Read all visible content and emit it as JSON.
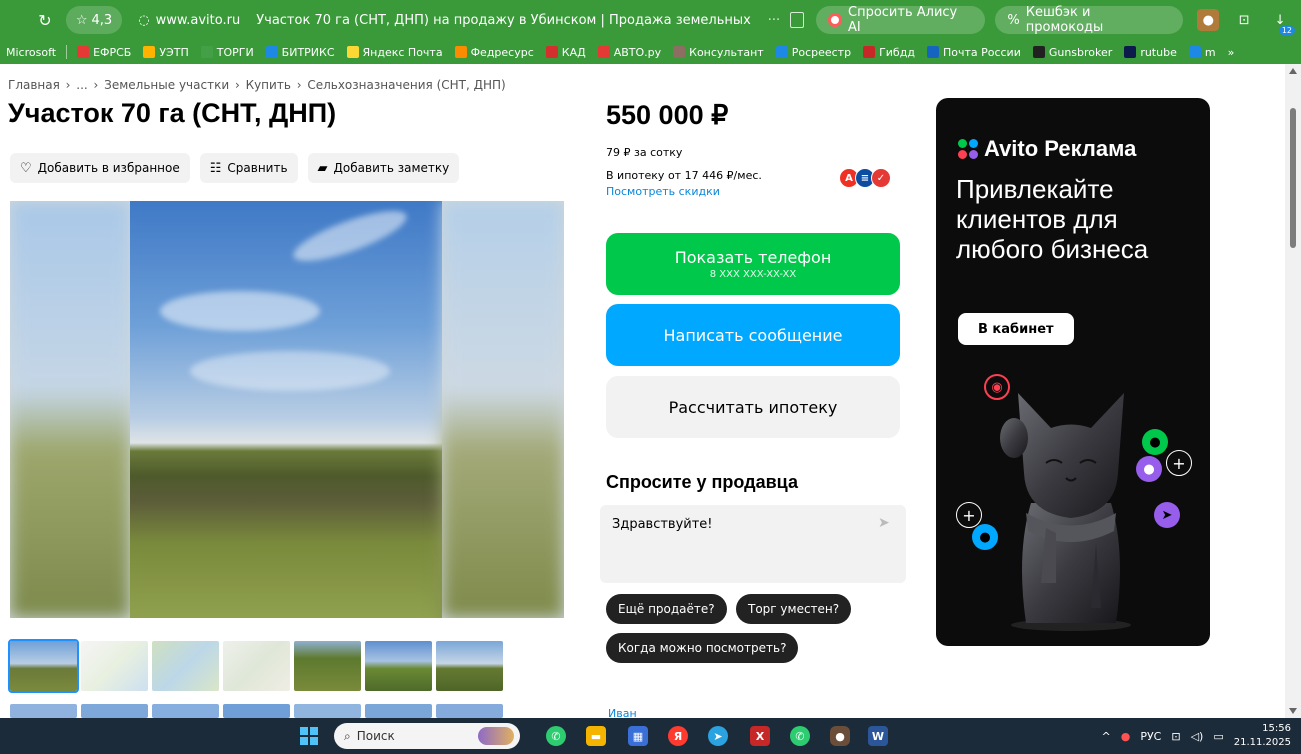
{
  "browser": {
    "rating": "4,3",
    "url": "www.avito.ru",
    "tab_title": "Участок 70 га (СНТ, ДНП) на продажу в Убинском | Продажа земельных у...",
    "ask_alice": "Спросить Алису AI",
    "cashback": "Кешбэк и промокоды",
    "badge_count": "12"
  },
  "bookmarks": [
    {
      "label": "Microsoft",
      "color": "#ffffff"
    },
    {
      "label": "ЕФРСБ",
      "color": "#e53935"
    },
    {
      "label": "УЭТП",
      "color": "#ffb300"
    },
    {
      "label": "ТОРГИ",
      "color": "#43a047"
    },
    {
      "label": "БИТРИКС",
      "color": "#1e88e5"
    },
    {
      "label": "Яндекс Почта",
      "color": "#fdd835"
    },
    {
      "label": "Федресурс",
      "color": "#fb8c00"
    },
    {
      "label": "КАД",
      "color": "#d32f2f"
    },
    {
      "label": "АВТО.ру",
      "color": "#e53935"
    },
    {
      "label": "Консультант",
      "color": "#8d6e63"
    },
    {
      "label": "Росреестр",
      "color": "#1e88e5"
    },
    {
      "label": "Гибдд",
      "color": "#c62828"
    },
    {
      "label": "Почта России",
      "color": "#1565c0"
    },
    {
      "label": "Gunsbroker",
      "color": "#212121"
    },
    {
      "label": "rutube",
      "color": "#0d1b4c"
    },
    {
      "label": "m",
      "color": "#1e88e5"
    }
  ],
  "breadcrumb": [
    "Главная",
    "...",
    "Земельные участки",
    "Купить",
    "Сельхозназначения (СНТ, ДНП)"
  ],
  "listing": {
    "title": "Участок 70 га (СНТ, ДНП)",
    "actions": {
      "favorite": "Добавить в избранное",
      "compare": "Сравнить",
      "note": "Добавить заметку"
    },
    "price": "550 000 ₽",
    "price_per_hundred": "79 ₽ за сотку",
    "mortgage_text": "В ипотеку от 17 446 ₽/мес.",
    "mortgage_link": "Посмотреть скидки",
    "show_phone": "Показать телефон",
    "phone_mask": "8 XXX XXX-XX-XX",
    "write_message": "Написать сообщение",
    "calc_mortgage": "Рассчитать ипотеку",
    "ask_title": "Спросите у продавца",
    "ask_placeholder": "Здравствуйте!",
    "chips": [
      "Ещё продаёте?",
      "Торг уместен?",
      "Когда можно посмотреть?"
    ],
    "seller_name": "Иван"
  },
  "ad": {
    "brand": "Avito Реклама",
    "headline": "Привлекайте клиентов для любого бизнеса",
    "button": "В кабинет"
  },
  "taskbar": {
    "search": "Поиск",
    "lang": "РУС",
    "time": "15:56",
    "date": "21.11.2025"
  },
  "colors": {
    "browser_bar": "#3a9a3a",
    "green_button": "#00c84a",
    "blue_button": "#00a8ff",
    "link": "#0a86d8"
  }
}
